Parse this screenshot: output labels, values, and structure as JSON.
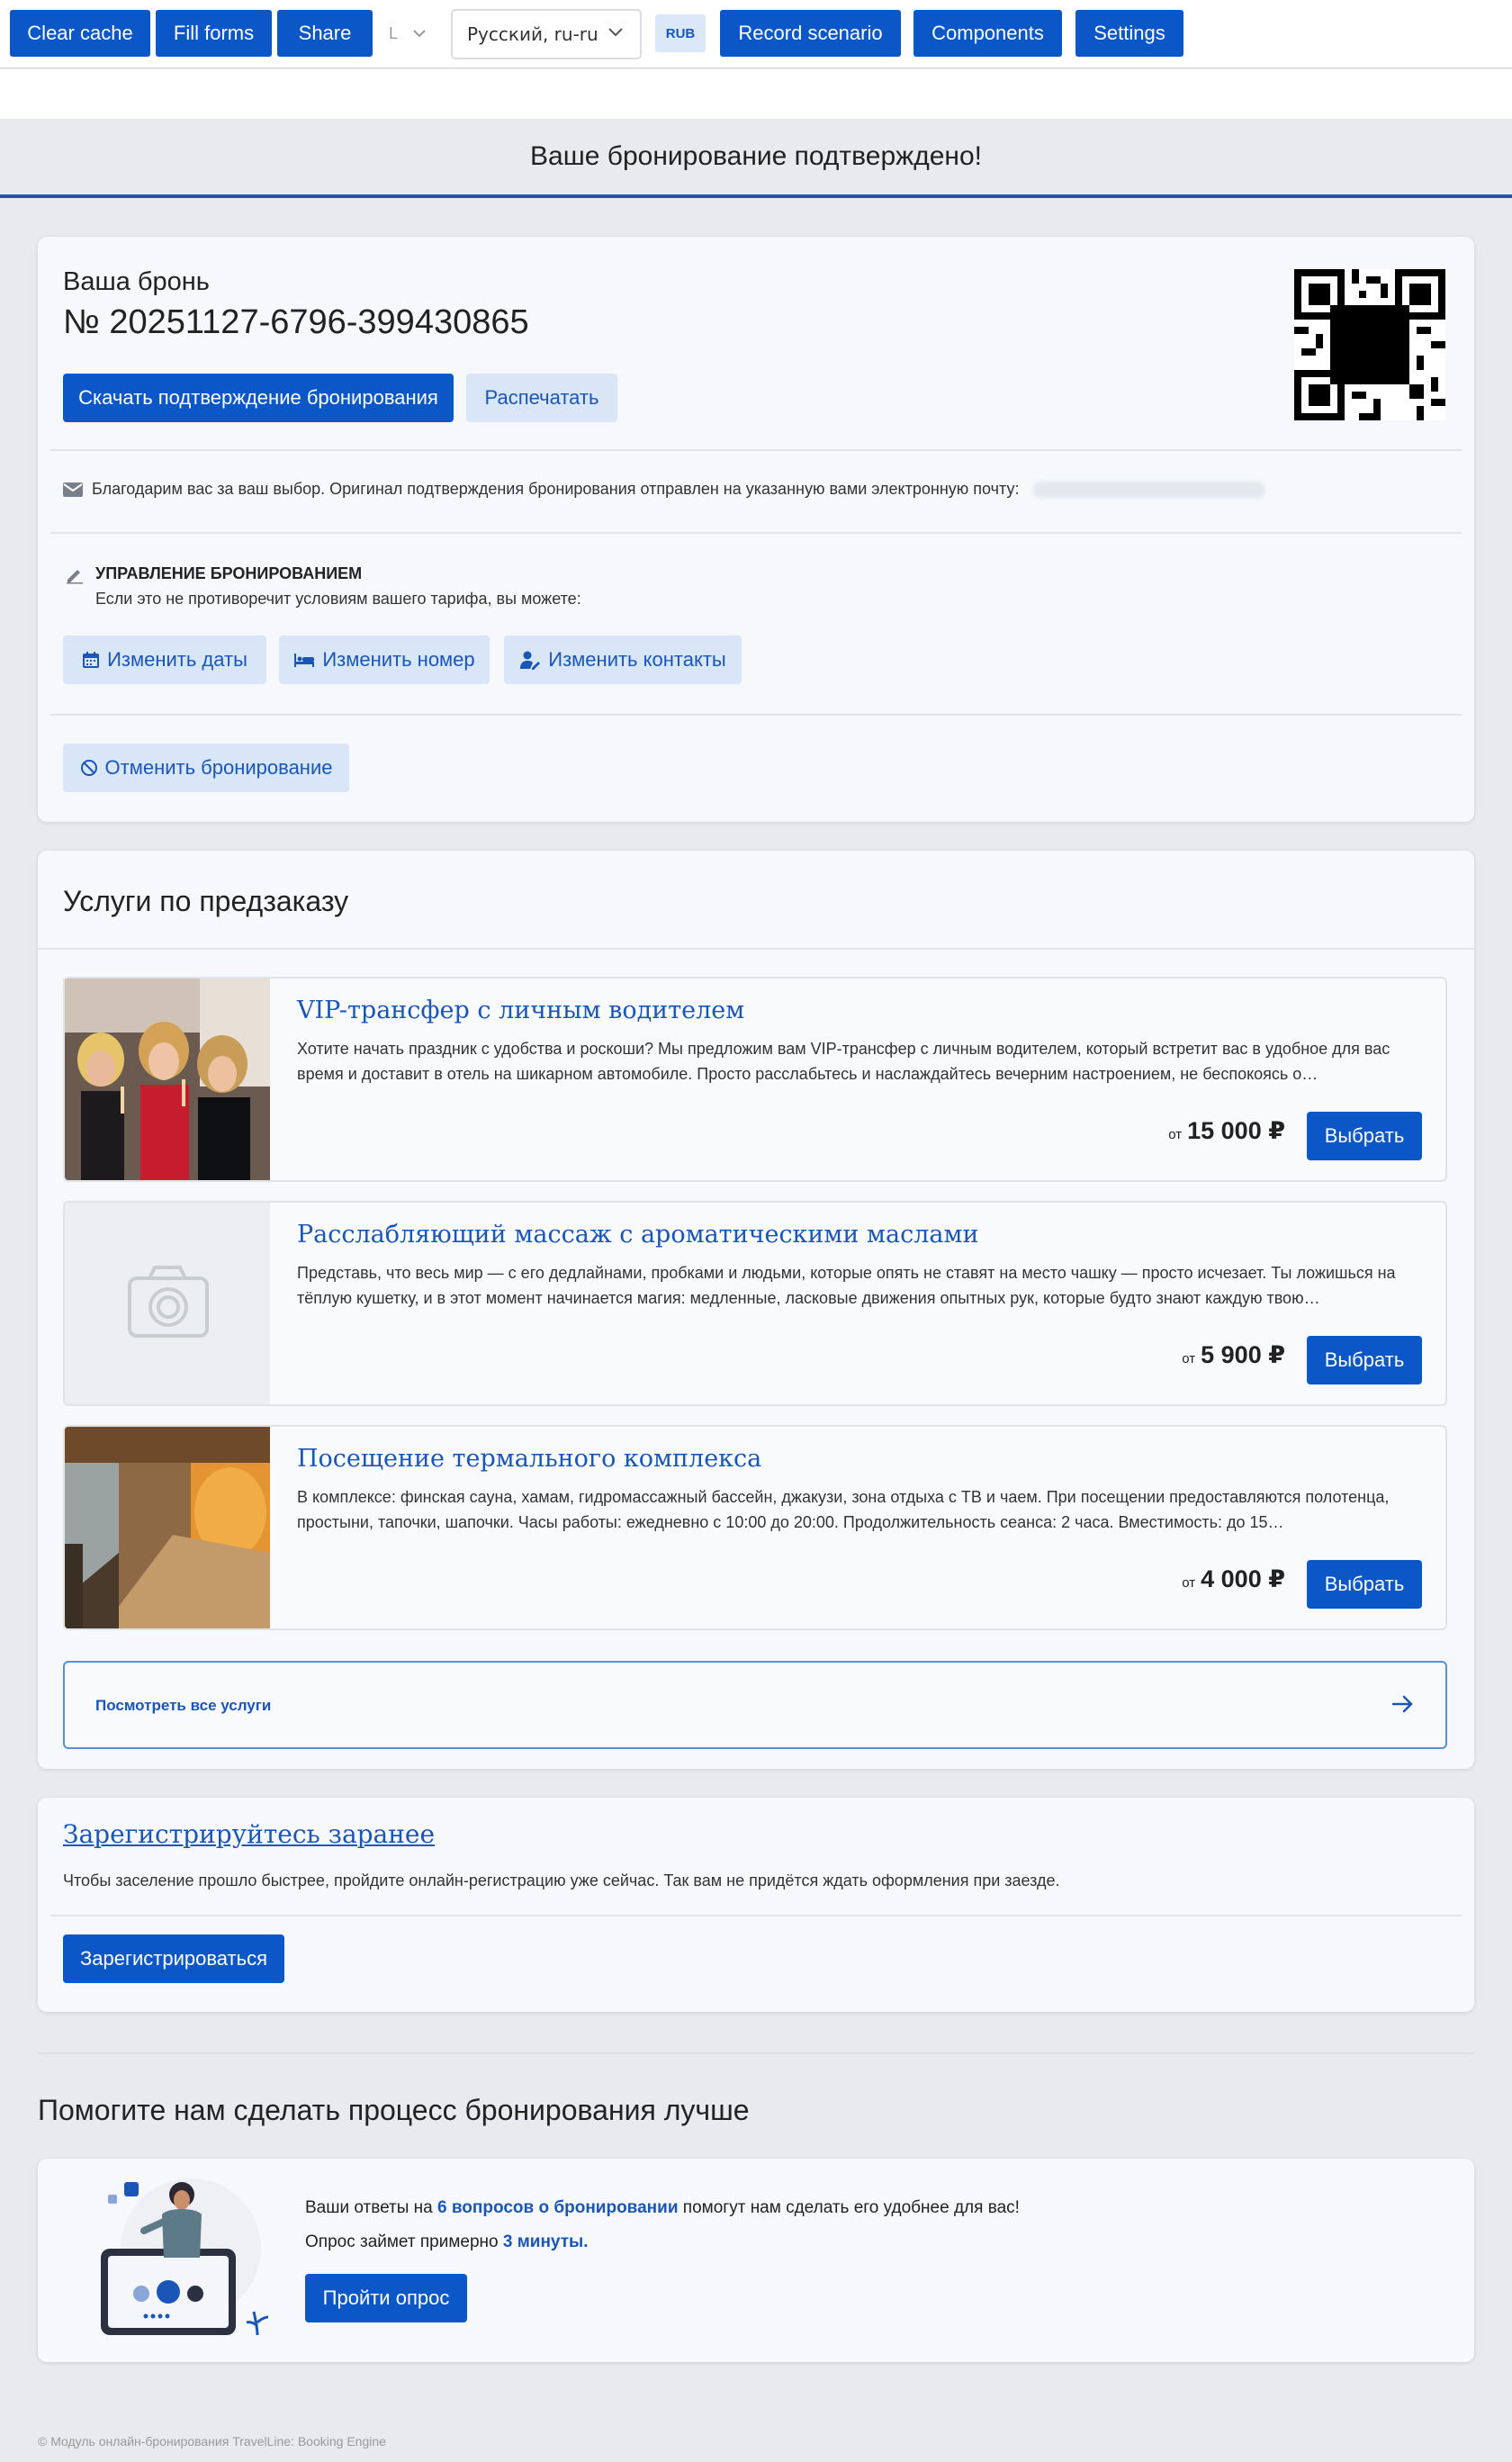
{
  "toolbar": {
    "clear_cache": "Clear cache",
    "fill_forms": "Fill forms",
    "share": "Share",
    "small_select": "L",
    "language": "Русский, ru-ru",
    "currency": "RUB",
    "record_scenario": "Record scenario",
    "components": "Components",
    "settings": "Settings"
  },
  "header": {
    "title": "Ваше бронирование подтверждено!"
  },
  "booking": {
    "label": "Ваша бронь",
    "number": "№ 20251127-6796-399430865",
    "download_button": "Скачать подтверждение бронирования",
    "print_button": "Распечатать",
    "email_note": "Благодарим вас за ваш выбор. Оригинал подтверждения бронирования отправлен на указанную вами электронную почту:",
    "manage_title": "УПРАВЛЕНИЕ БРОНИРОВАНИЕМ",
    "manage_sub": "Если это не противоречит условиям вашего тарифа, вы можете:",
    "change_dates": "Изменить даты",
    "change_room": "Изменить номер",
    "change_contacts": "Изменить контакты",
    "cancel": "Отменить бронирование"
  },
  "services": {
    "title": "Услуги по предзаказу",
    "items": [
      {
        "name": "VIP-трансфер с личным водителем",
        "description": "Хотите начать праздник с удобства и роскоши? Мы предложим вам VIP-трансфер с личным водителем, который встретит вас в удобное для вас время и доставит в отель на шикарном автомобиле. Просто расслабьтесь и наслаждайтесь вечерним настроением, не беспокоясь о…",
        "price_from": "от",
        "price": "15 000 ₽",
        "select": "Выбрать"
      },
      {
        "name": "Расслабляющий массаж с ароматическими маслами",
        "description": "Представь, что весь мир — с его дедлайнами, пробками и людьми, которые опять не ставят на место чашку — просто исчезает. Ты ложишься на тёплую кушетку, и в этот момент начинается магия: медленные, ласковые движения опытных рук, которые будто знают каждую твою…",
        "price_from": "от",
        "price": "5 900 ₽",
        "select": "Выбрать"
      },
      {
        "name": "Посещение термального комплекса",
        "description": "В комплексе: финская сауна, хамам, гидромассажный бассейн, джакузи, зона отдыха с ТВ и чаем. При посещении предоставляются полотенца, простыни, тапочки, шапочки. Часы работы: ежедневно с 10:00 до 20:00. Продолжительность сеанса: 2 часа. Вместимость: до 15…",
        "price_from": "от",
        "price": "4 000 ₽",
        "select": "Выбрать"
      }
    ],
    "see_all": "Посмотреть все услуги"
  },
  "register": {
    "title": "Зарегистрируйтесь заранее",
    "text": "Чтобы заселение прошло быстрее, пройдите онлайн-регистрацию уже сейчас. Так вам не придётся ждать оформления при заезде.",
    "button": "Зарегистрироваться"
  },
  "survey": {
    "heading": "Помогите нам сделать процесс бронирования лучше",
    "line1_a": "Ваши ответы на",
    "line1_b": "6 вопросов о бронировании",
    "line1_c": "помогут нам сделать его удобнее для вас!",
    "line2_a": "Опрос займет примерно",
    "line2_b": "3 минуты.",
    "button": "Пройти опрос"
  },
  "footer": {
    "text": "© Модуль онлайн-бронирования TravelLine: Booking Engine"
  },
  "colors": {
    "accent": "#0b57c8",
    "link": "#1a56b8",
    "light_button": "#d8e6f8",
    "page_bg": "#e8eaee"
  }
}
